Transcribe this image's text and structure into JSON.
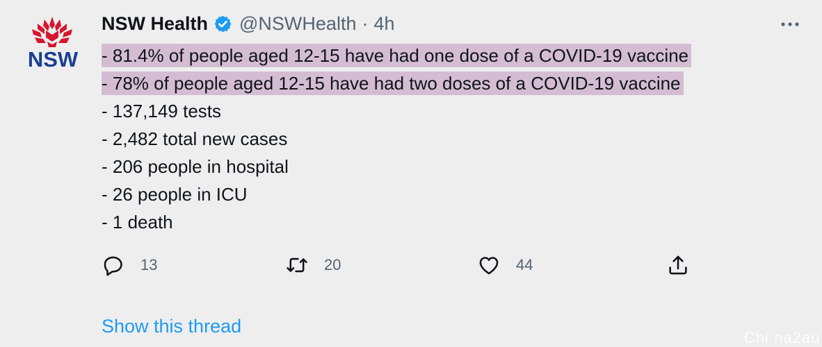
{
  "avatar": {
    "logo_text": "NSW",
    "icon": "waratah-flower-icon",
    "brand_blue": "#1b3f94",
    "brand_red": "#d7152f"
  },
  "header": {
    "display_name": "NSW Health",
    "verified_icon": "verified-badge-icon",
    "handle": "@NSWHealth",
    "separator": "·",
    "time": "4h",
    "more_icon": "more-dots-icon"
  },
  "body": {
    "lines": [
      {
        "text": "- 81.4% of people aged 12-15 have had one dose of a COVID-19 vaccine",
        "highlighted": true
      },
      {
        "text": "- 78% of people aged 12-15 have had two doses of a COVID-19 vaccine",
        "highlighted": true
      },
      {
        "text": "- 137,149 tests",
        "highlighted": false
      },
      {
        "text": "- 2,482 total new cases",
        "highlighted": false
      },
      {
        "text": "- 206 people in hospital",
        "highlighted": false
      },
      {
        "text": "- 26 people in ICU",
        "highlighted": false
      },
      {
        "text": "- 1 death",
        "highlighted": false
      }
    ],
    "highlight_color": "#d4bdd3"
  },
  "actions": {
    "reply": {
      "icon": "reply-icon",
      "count": "13"
    },
    "retweet": {
      "icon": "retweet-icon",
      "count": "20"
    },
    "like": {
      "icon": "heart-icon",
      "count": "44"
    },
    "share": {
      "icon": "share-icon"
    }
  },
  "show_thread": "Show this thread",
  "watermark": "Chi na2au",
  "colors": {
    "background": "#eeeeef",
    "secondary_text": "#536471",
    "link": "#1d9bf0",
    "verified": "#1d9bf0"
  }
}
